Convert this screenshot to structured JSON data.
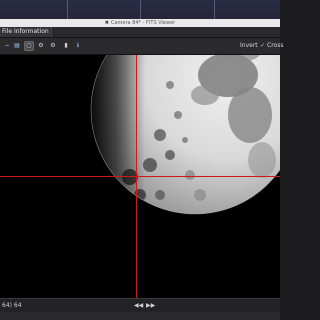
{
  "window": {
    "title": "Camera 84* - FITS Viewer",
    "app_icon": "wrench-icon"
  },
  "tabs": [
    {
      "label": "File Information"
    }
  ],
  "toolbar": {
    "buttons": [
      {
        "icon": "zoom-out-icon",
        "glyph": "−"
      },
      {
        "icon": "image-stretch-icon",
        "glyph": "▤"
      },
      {
        "icon": "fit-to-screen-icon",
        "glyph": "▢",
        "selected": true
      },
      {
        "icon": "settings-gear-icon",
        "glyph": "⚙"
      },
      {
        "icon": "histogram-icon",
        "glyph": "⚙"
      },
      {
        "icon": "bookmark-icon",
        "glyph": "▮"
      },
      {
        "icon": "info-icon",
        "glyph": "ℹ"
      }
    ],
    "invert_label": "Invert",
    "crosshair_label": "Cross",
    "crosshair_checked": true,
    "check_glyph": "✓"
  },
  "status": {
    "coords": "64) 64"
  },
  "nav": {
    "prev_glyph": "◀◀",
    "next_glyph": "▶▶"
  },
  "colors": {
    "crosshair": "#d01818",
    "background": "#000000"
  }
}
